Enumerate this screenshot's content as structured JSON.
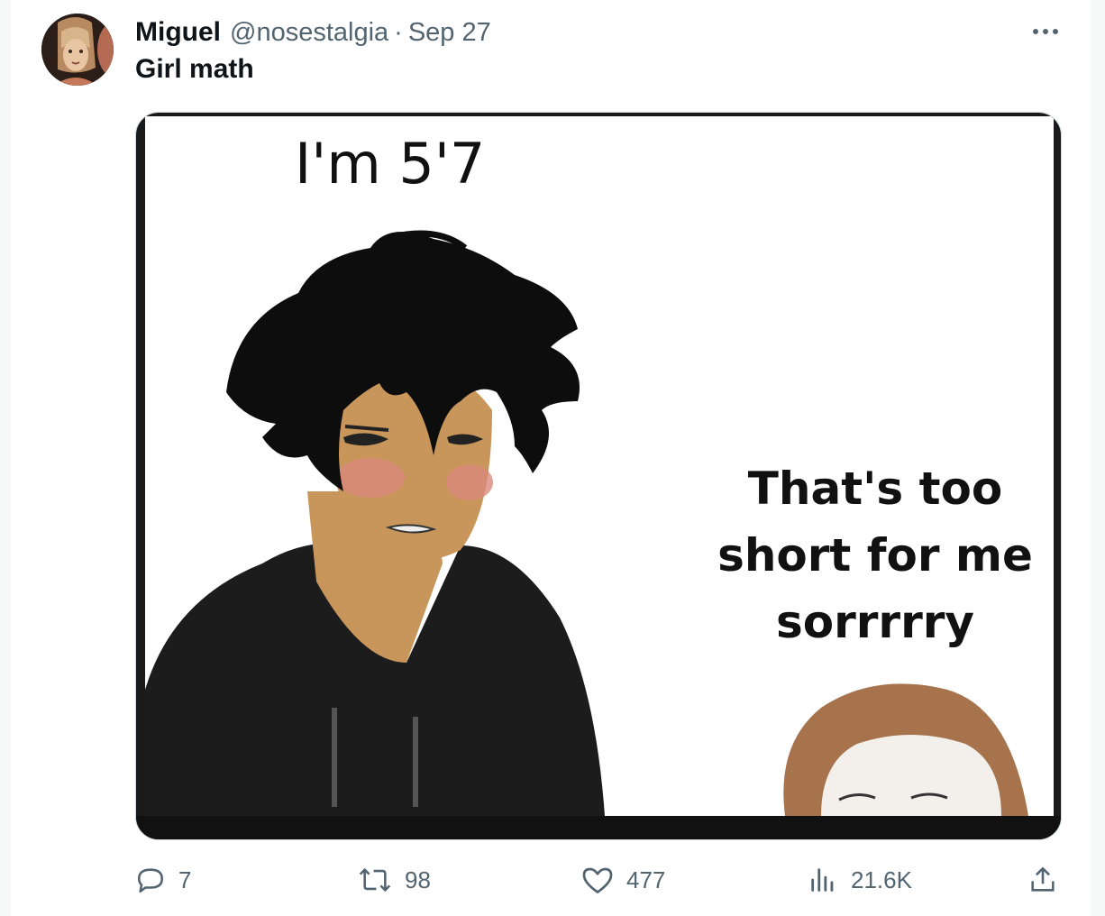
{
  "tweet": {
    "author_name": "Miguel",
    "handle": "@nosestalgia",
    "separator": "·",
    "date": "Sep 27",
    "text": "Girl math"
  },
  "meme": {
    "top_text": "I'm 5'7",
    "reply_lines": [
      "That's too",
      "short for me",
      "sorrrrry"
    ]
  },
  "actions": {
    "replies": "7",
    "retweets": "98",
    "likes": "477",
    "views": "21.6K"
  },
  "colors": {
    "text_primary": "#0f1419",
    "text_secondary": "#536471",
    "border": "#cfd9de"
  },
  "icons": [
    "more-icon",
    "reply-icon",
    "retweet-icon",
    "like-icon",
    "views-icon",
    "share-icon"
  ]
}
